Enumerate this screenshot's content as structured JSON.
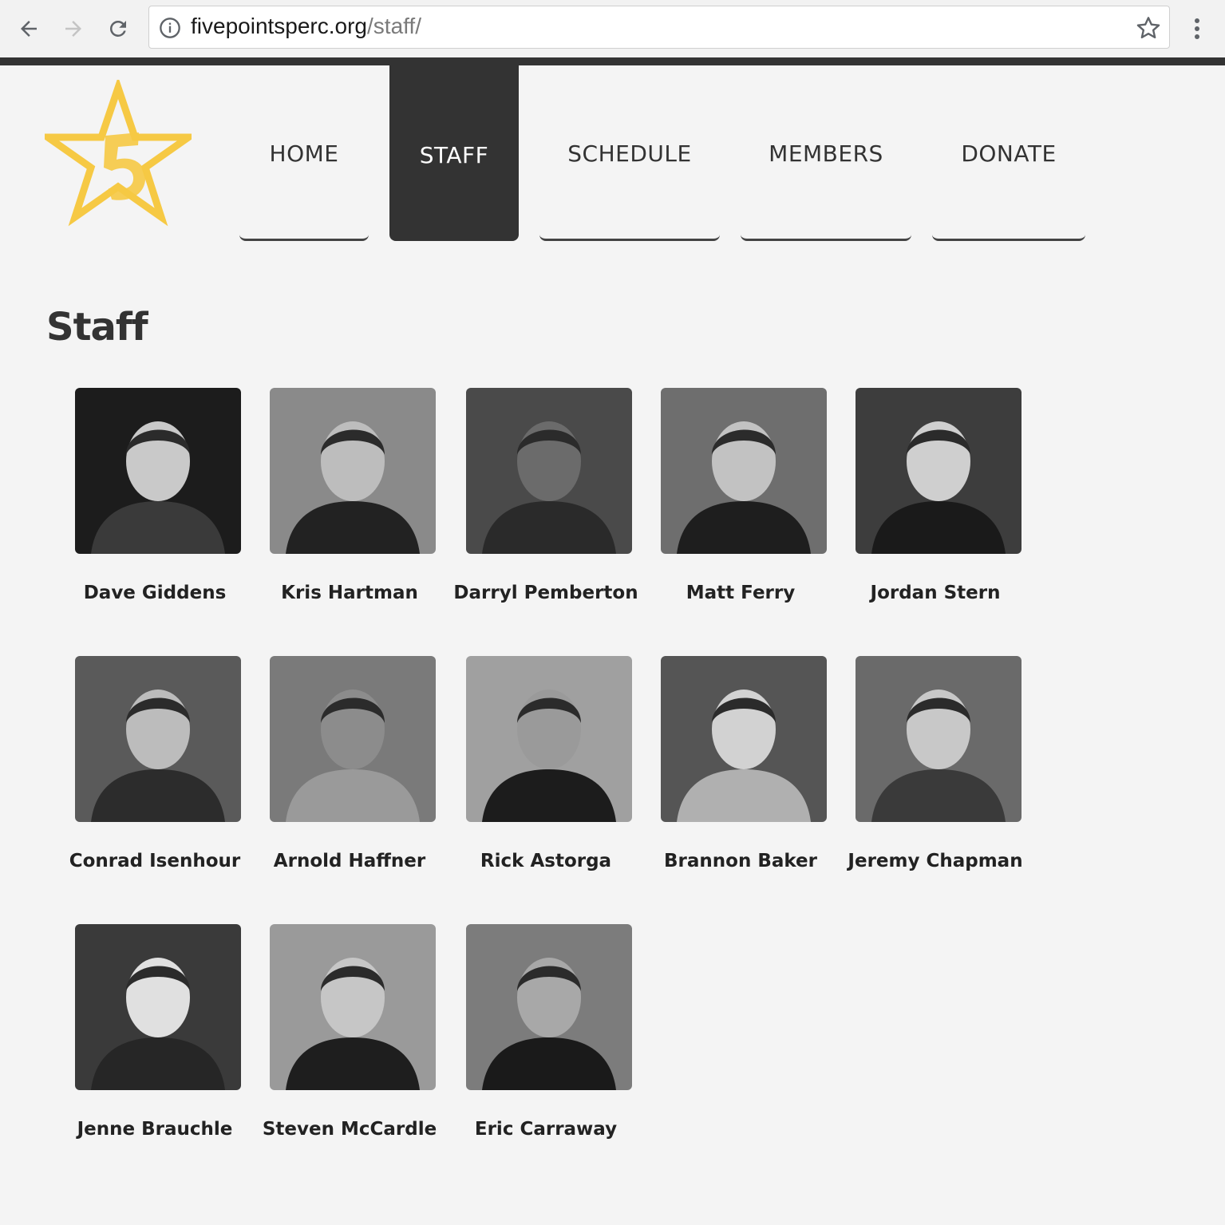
{
  "browser": {
    "url_host": "fivepointsperc.org",
    "url_path": "/staff/"
  },
  "site": {
    "nav": [
      {
        "label": "HOME",
        "active": false
      },
      {
        "label": "STAFF",
        "active": true
      },
      {
        "label": "SCHEDULE",
        "active": false
      },
      {
        "label": "MEMBERS",
        "active": false
      },
      {
        "label": "DONATE",
        "active": false
      }
    ],
    "logo_color": "#f6c944",
    "accent_dark": "#333333"
  },
  "main": {
    "title": "Staff",
    "staff": [
      {
        "name": "Dave Giddens"
      },
      {
        "name": "Kris Hartman"
      },
      {
        "name": "Darryl Pemberton"
      },
      {
        "name": "Matt Ferry"
      },
      {
        "name": "Jordan Stern"
      },
      {
        "name": "Conrad Isenhour"
      },
      {
        "name": "Arnold Haffner"
      },
      {
        "name": "Rick Astorga"
      },
      {
        "name": "Brannon Baker"
      },
      {
        "name": "Jeremy Chapman"
      },
      {
        "name": "Jenne Brauchle"
      },
      {
        "name": "Steven McCardle"
      },
      {
        "name": "Eric Carraway"
      }
    ]
  }
}
